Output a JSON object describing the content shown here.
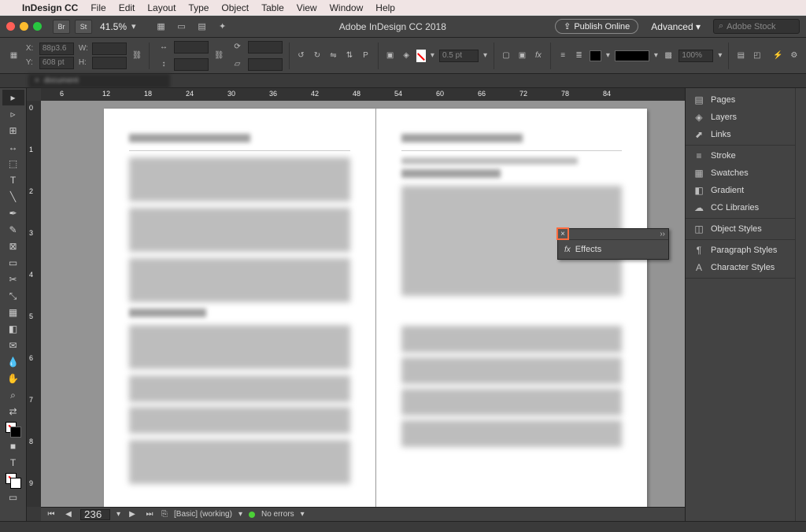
{
  "menubar": {
    "app": "InDesign CC",
    "items": [
      "File",
      "Edit",
      "Layout",
      "Type",
      "Object",
      "Table",
      "View",
      "Window",
      "Help"
    ]
  },
  "appbar": {
    "bridge": "Br",
    "stock": "St",
    "zoom": "41.5%",
    "title": "Adobe InDesign CC 2018",
    "publish": "Publish Online",
    "workspace": "Advanced",
    "search_placeholder": "Adobe Stock"
  },
  "control": {
    "x_label": "X:",
    "x_val": "88p3.6",
    "y_label": "Y:",
    "y_val": "608 pt",
    "w_label": "W:",
    "w_val": "",
    "h_label": "H:",
    "h_val": "",
    "stroke_weight": "0.5 pt",
    "opacity": "100%"
  },
  "ruler_h": [
    "6",
    "12",
    "18",
    "24",
    "30",
    "36",
    "42",
    "48",
    "54",
    "60",
    "66",
    "72",
    "78",
    "84"
  ],
  "ruler_v": [
    "0",
    "1",
    "2",
    "3",
    "4",
    "5",
    "6",
    "7",
    "8",
    "9"
  ],
  "effects_panel": {
    "title": "Effects"
  },
  "status": {
    "page": "236",
    "profile": "[Basic] (working)",
    "errors": "No errors"
  },
  "dock": {
    "g1": [
      {
        "icon": "pages",
        "label": "Pages"
      },
      {
        "icon": "layers",
        "label": "Layers"
      },
      {
        "icon": "links",
        "label": "Links"
      }
    ],
    "g2": [
      {
        "icon": "stroke",
        "label": "Stroke"
      },
      {
        "icon": "swatches",
        "label": "Swatches"
      },
      {
        "icon": "gradient",
        "label": "Gradient"
      },
      {
        "icon": "cc",
        "label": "CC Libraries"
      }
    ],
    "g3": [
      {
        "icon": "obj",
        "label": "Object Styles"
      }
    ],
    "g4": [
      {
        "icon": "para",
        "label": "Paragraph Styles"
      },
      {
        "icon": "char",
        "label": "Character Styles"
      }
    ]
  },
  "tools": [
    "selection",
    "direct",
    "page",
    "gap",
    "content",
    "type",
    "line",
    "pen",
    "pencil",
    "rect-frame",
    "rect",
    "scissors",
    "free-transform",
    "gradient-swatch",
    "note",
    "eyedropper",
    "hand",
    "zoom"
  ]
}
